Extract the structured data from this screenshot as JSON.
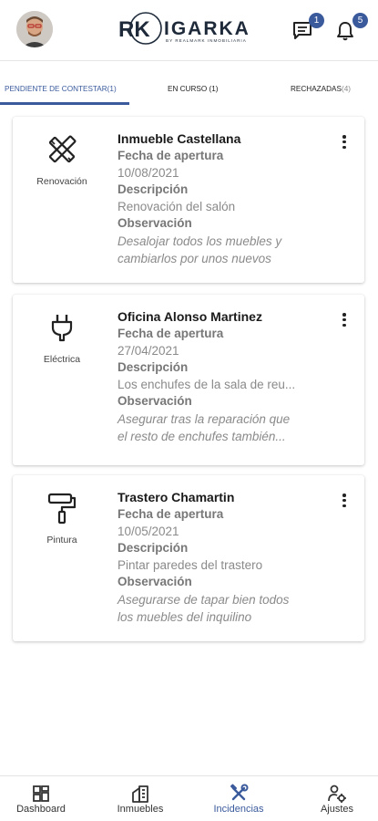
{
  "header": {
    "logo_text": "IGARKA",
    "logo_mark": "RK",
    "logo_subtitle": "BY REALMARK INMOBILIARIA",
    "messages_badge": "1",
    "notifications_badge": "5"
  },
  "tabs": [
    {
      "label": "PENDIENTE DE CONTESTAR(1)",
      "active": true
    },
    {
      "label": "EN CURSO (1)",
      "active": false
    },
    {
      "label": "RECHAZADAS",
      "count": "(4)",
      "active": false
    }
  ],
  "cards": [
    {
      "category": "Renovación",
      "icon": "tools-icon",
      "title": "Inmueble Castellana",
      "opening_label": "Fecha de apertura",
      "opening_date": "10/08/2021",
      "description_label": "Descripción",
      "description": "Renovación del salón",
      "observation_label": "Observación",
      "observation_line1": "Desalojar todos los muebles y",
      "observation_line2": "cambiarlos por unos nuevos"
    },
    {
      "category": "Eléctrica",
      "icon": "plug-icon",
      "title": "Oficina Alonso Martinez",
      "opening_label": "Fecha de apertura",
      "opening_date": "27/04/2021",
      "description_label": "Descripción",
      "description": "Los enchufes de la sala de reu...",
      "observation_label": "Observación",
      "observation_line1": "Asegurar tras la reparación que",
      "observation_line2": " el resto de enchufes también..."
    },
    {
      "category": "Pintura",
      "icon": "paint-roller-icon",
      "title": "Trastero Chamartin",
      "opening_label": "Fecha de apertura",
      "opening_date": "10/05/2021",
      "description_label": "Descripción",
      "description": "Pintar paredes del trastero",
      "observation_label": "Observación",
      "observation_line1": "Asegurarse de tapar bien todos",
      "observation_line2": "los muebles del inquilino"
    }
  ],
  "bottom_nav": [
    {
      "label": "Dashboard",
      "icon": "dashboard-icon",
      "active": false
    },
    {
      "label": "Inmuebles",
      "icon": "building-icon",
      "active": false
    },
    {
      "label": "Incidencias",
      "icon": "wrench-hammer-icon",
      "active": true
    },
    {
      "label": "Ajustes",
      "icon": "user-settings-icon",
      "active": false
    }
  ],
  "colors": {
    "accent": "#3a5a9c",
    "logo": "#1e2a3a",
    "label_gray": "#777777",
    "value_gray": "#8a8a8a"
  }
}
